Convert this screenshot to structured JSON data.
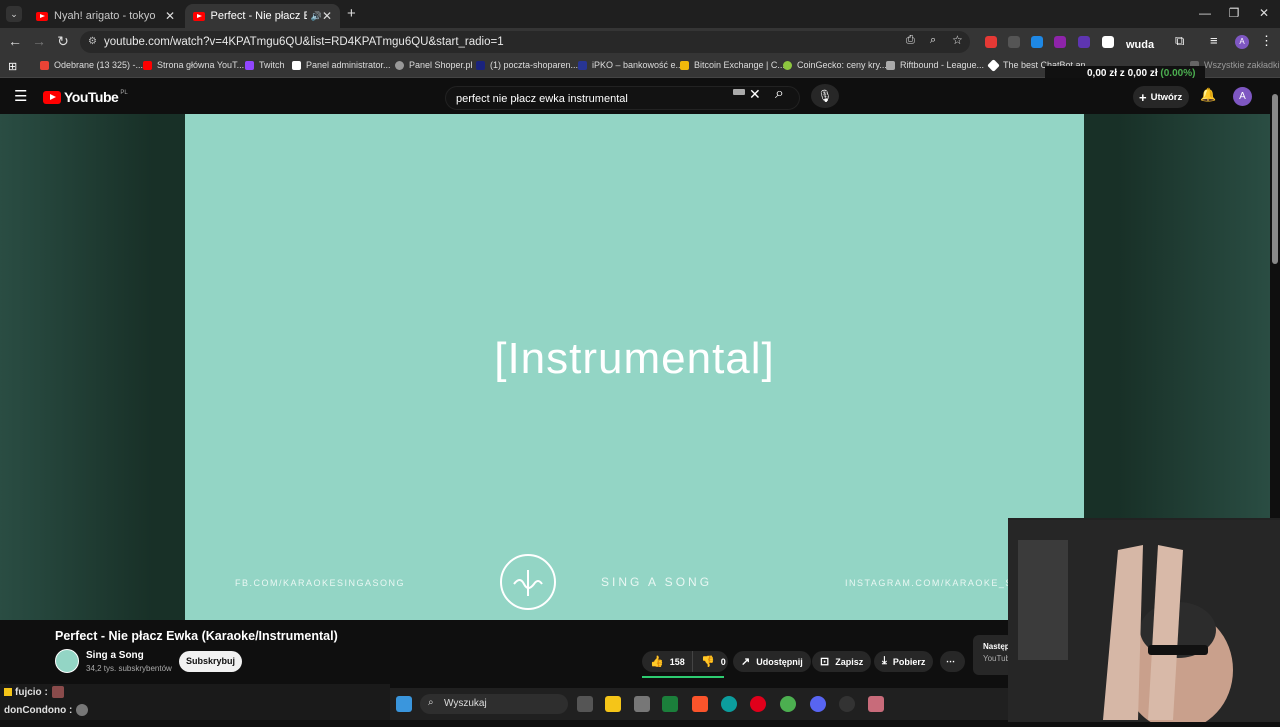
{
  "browser": {
    "tabs": [
      {
        "title": "Nyah! arigato - tokyo - Leat'eq",
        "active": false
      },
      {
        "title": "Perfect - Nie płacz Ewka (Ka",
        "active": true
      }
    ],
    "url": "youtube.com/watch?v=4KPATmgu6QU&list=RD4KPATmgu6QU&start_radio=1",
    "bookmarks": [
      "Odebrane (13 325) -...",
      "Strona główna YouT...",
      "Twitch",
      "Panel administrator...",
      "Panel Shoper.pl",
      "(1) poczta-shoparen...",
      "iPKO – bankowość e...",
      "Bitcoin Exchange | C...",
      "CoinGecko: ceny kry...",
      "Riftbound - League...",
      "The best ChatBot an..."
    ],
    "all_bookmarks": "Wszystkie zakładki",
    "balance": {
      "prefix": "0,00 zł z",
      "value": "0,00 zł",
      "percent": "(0.00%)"
    },
    "wuda_label": "wuda"
  },
  "youtube": {
    "logo_text": "YouTube",
    "region": "PL",
    "search_query": "perfect nie płacz ewka instrumental",
    "create_label": "Utwórz",
    "avatar_letter": "A"
  },
  "video": {
    "overlay_text": "[Instrumental]",
    "footer_left": "FB.COM/KARAOKESINGASONG",
    "footer_center": "SING A SONG",
    "footer_right": "INSTAGRAM.COM/KARAOKE_SIN",
    "title": "Perfect - Nie płacz Ewka (Karaoke/Instrumental)",
    "channel_name": "Sing a Song",
    "channel_subs": "34,2 tys. subskrybentów",
    "subscribe_label": "Subskrybuj",
    "likes": "158",
    "dislikes": "0",
    "share_label": "Udostępnij",
    "save_label": "Zapisz",
    "download_label": "Pobierz",
    "next_label": "Następ",
    "next_sub": "YouTub"
  },
  "chat": [
    {
      "user": "fujcio :"
    },
    {
      "user": "donCondono :"
    }
  ],
  "taskbar": {
    "search_placeholder": "Wyszukaj"
  },
  "colors": {
    "video_bg": "#93d5c5",
    "yt_red": "#ff0000",
    "balance_green": "#4caf50"
  }
}
